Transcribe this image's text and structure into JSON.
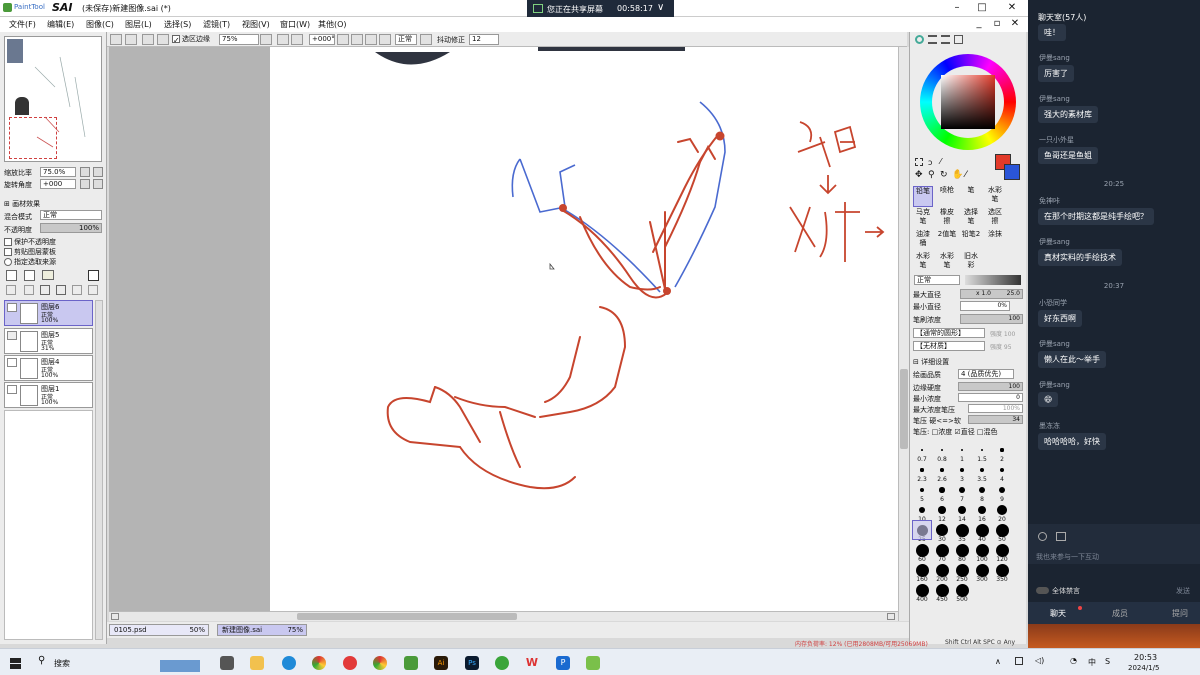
{
  "app": {
    "name": "PaintTool",
    "name_bold": "SAI",
    "doc_title": "(未保存)新建图像.sai (*)"
  },
  "share": {
    "text": "您正在共享屏幕",
    "time": "00:58:17"
  },
  "menu": [
    "文件(F)",
    "编辑(E)",
    "图像(C)",
    "图层(L)",
    "选择(S)",
    "滤镜(T)",
    "视图(V)",
    "窗口(W)",
    "其他(O)"
  ],
  "toolbar": {
    "select_source": "选区边缘",
    "zoom": "75%",
    "angle": "+000°",
    "mode": "正常",
    "stabilizer_label": "抖动修正",
    "stabilizer": "12"
  },
  "left": {
    "zoom_label": "缩放比率",
    "zoom_val": "75.0%",
    "rot_label": "旋转角度",
    "rot_val": "+000",
    "effects_label": "画材效果",
    "blend_label": "混合模式",
    "blend_val": "正常",
    "opacity_label": "不透明度",
    "opacity_val": "100%",
    "opt1": "保护不透明度",
    "opt2": "剪贴图层蒙板",
    "opt3": "指定选取来源",
    "layers": [
      {
        "name": "图层6",
        "mode": "正常",
        "opacity": "100%"
      },
      {
        "name": "图层5",
        "mode": "正常",
        "opacity": "31%"
      },
      {
        "name": "图层4",
        "mode": "正常",
        "opacity": "100%"
      },
      {
        "name": "图层1",
        "mode": "正常",
        "opacity": "100%"
      }
    ]
  },
  "doc_tabs": [
    {
      "name": "0105.psd",
      "zoom": "50%"
    },
    {
      "name": "新建图像.sai",
      "zoom": "75%"
    }
  ],
  "canvas_note": "衣褶 ↓ 好看→",
  "right": {
    "tools": [
      "铅笔",
      "喷枪",
      "笔",
      "水彩笔",
      "马克笔",
      "橡皮擦",
      "选择笔",
      "选区擦",
      "油漆桶",
      "2值笔",
      "铅笔2",
      "涂抹",
      "水彩笔",
      "水彩笔",
      "旧水彩",
      ""
    ],
    "mode": "正常",
    "max_dia_label": "最大直径",
    "max_dia_mult": "x 1.0",
    "max_dia_val": "25.0",
    "min_dia_label": "最小直径",
    "min_dia_val": "0%",
    "density_label": "笔刷浓度",
    "density_val": "100",
    "shape_label": "【通常的圆形】",
    "shape_val": "强度 100",
    "texture_label": "【无材质】",
    "texture_val": "强度 95",
    "adv_label": "详细设置",
    "quality_label": "绘画品质",
    "quality_val": "4 (品质优先)",
    "edge_label": "边缘硬度",
    "edge_val": "100",
    "min_den_label": "最小浓度",
    "min_den_val": "0",
    "max_den_label": "最大浓度笔压",
    "max_den_val": "100%",
    "press_label": "笔压 硬<=>软",
    "press_val": "34",
    "press_opts": "笔压: □浓度 ☑直径 □混色",
    "brush_sizes": [
      "0.7",
      "0.8",
      "1",
      "1.5",
      "2",
      "2.3",
      "2.6",
      "3",
      "3.5",
      "4",
      "5",
      "6",
      "7",
      "8",
      "9",
      "10",
      "12",
      "14",
      "16",
      "20",
      "25",
      "30",
      "35",
      "40",
      "50",
      "60",
      "70",
      "80",
      "100",
      "120",
      "160",
      "200",
      "250",
      "300",
      "350",
      "400",
      "450",
      "500"
    ]
  },
  "status": {
    "memory": "内存负荷率: 12% (已用2808MB/可用25069MB)",
    "keys": "Shift Ctrl Alt SPC ⊙ Any"
  },
  "chat": {
    "header": "聊天室(57人)",
    "messages": [
      {
        "user": "",
        "text": "哇！"
      },
      {
        "user": "伊曼sang",
        "text": "厉害了"
      },
      {
        "user": "伊曼sang",
        "text": "强大的素材库"
      },
      {
        "user": "一只小外星",
        "text": "鱼哥还是鱼姐"
      },
      {
        "time": "20:25"
      },
      {
        "user": "免神咔",
        "text": "在那个时期这都是纯手绘吧？"
      },
      {
        "user": "伊曼sang",
        "text": "真材实料的手绘技术"
      },
      {
        "time": "20:37"
      },
      {
        "user": "小恐同学",
        "text": "好东西啊"
      },
      {
        "user": "伊曼sang",
        "text": "懒人在此～举手"
      },
      {
        "user": "伊曼sang",
        "text": "😄"
      },
      {
        "user": "墨冻冻",
        "text": "哈哈哈哈，好快"
      }
    ],
    "input_placeholder": "我也来参与一下互动",
    "mute_label": "全体禁言",
    "send_label": "发送",
    "tabs": [
      "聊天",
      "成员",
      "提问"
    ]
  },
  "taskbar": {
    "search": "搜索",
    "time": "20:53",
    "date": "2024/1/5",
    "lang": "中",
    "lang2": "S"
  },
  "colors": {
    "accent": "#c7452e",
    "chat_bg": "#1b2431",
    "layer_sel": "#c9c8f0"
  }
}
